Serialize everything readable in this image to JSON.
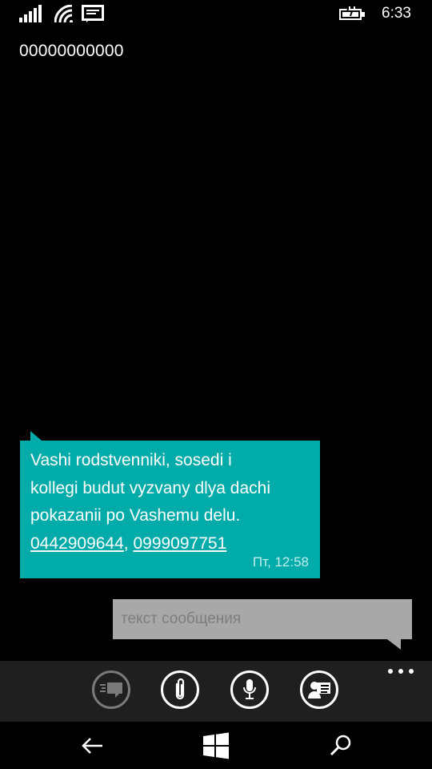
{
  "status": {
    "time": "6:33",
    "icons": [
      "signal-icon",
      "wifi-icon",
      "message-icon",
      "battery-charging-icon"
    ]
  },
  "conversation": {
    "contact": "00000000000"
  },
  "message": {
    "text_lines": [
      "Vashi rodstvenniki, sosedi i",
      "kollegi budut vyzvany dlya dachi",
      "pokazanii po Vashemu delu."
    ],
    "link1": "0442909644",
    "separator": ", ",
    "link2": "0999097751",
    "timestamp": "Пт, 12:58"
  },
  "compose": {
    "placeholder": "текст сообщения",
    "value": ""
  },
  "appbar": {
    "buttons": [
      "templates-icon",
      "attach-icon",
      "microphone-icon",
      "contact-card-icon"
    ],
    "more": "ellipsis-icon"
  },
  "navigation": {
    "buttons": [
      "back-icon",
      "windows-start-icon",
      "search-icon"
    ]
  },
  "colors": {
    "accent": "#00aba9",
    "compose_bg": "#a8a8a8",
    "appbar_bg": "#1f1f1f",
    "background": "#000000"
  }
}
